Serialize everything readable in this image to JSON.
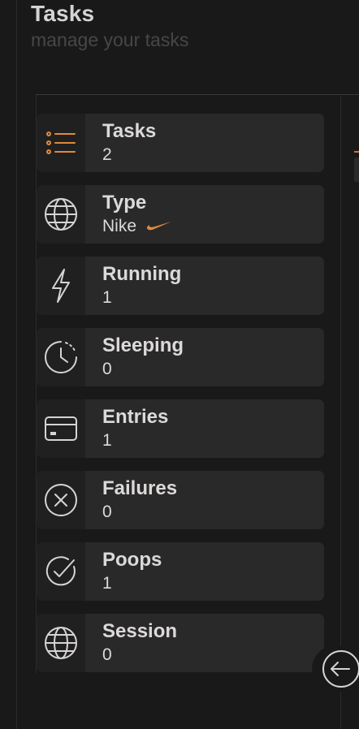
{
  "header": {
    "title": "Tasks",
    "subtitle": "manage your tasks"
  },
  "colors": {
    "background": "#1a1919",
    "card": "#2a2929",
    "icon_tile": "#212020",
    "text": "#dcdad9",
    "accent": "#e08a3c"
  },
  "stats": [
    {
      "label": "Tasks",
      "value": "2",
      "icon": "list-icon"
    },
    {
      "label": "Type",
      "value": "Nike",
      "icon": "globe-icon",
      "badge_icon": "nike-swoosh-icon"
    },
    {
      "label": "Running",
      "value": "1",
      "icon": "lightning-icon"
    },
    {
      "label": "Sleeping",
      "value": "0",
      "icon": "clock-icon"
    },
    {
      "label": "Entries",
      "value": "1",
      "icon": "credit-card-icon"
    },
    {
      "label": "Failures",
      "value": "0",
      "icon": "x-circle-icon"
    },
    {
      "label": "Poops",
      "value": "1",
      "icon": "check-circle-icon"
    },
    {
      "label": "Session",
      "value": "0",
      "icon": "globe-icon"
    }
  ],
  "controls": {
    "collapse_icon": "arrow-left-circle-icon"
  }
}
